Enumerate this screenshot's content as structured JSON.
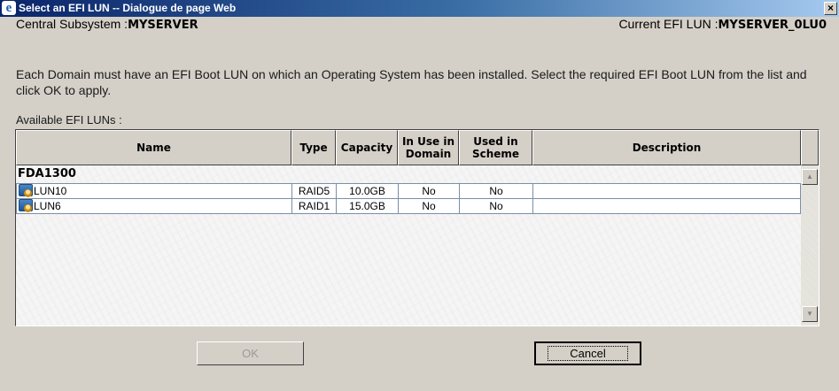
{
  "window": {
    "title": "Select an EFI LUN -- Dialogue de page Web",
    "close_glyph": "×"
  },
  "header": {
    "subsystem_label": "Central Subsystem :",
    "subsystem_value": "MYSERVER",
    "current_lun_label": "Current EFI LUN :",
    "current_lun_value": "MYSERVER_0LU0"
  },
  "instructions": "Each Domain must have an EFI Boot LUN on which an Operating System has been installed. Select the required EFI Boot LUN from the list and click OK to apply.",
  "list_label": "Available EFI LUNs :",
  "table": {
    "columns": [
      {
        "label": "Name"
      },
      {
        "label": "Type"
      },
      {
        "label": "Capacity"
      },
      {
        "label": "In Use in Domain"
      },
      {
        "label": "Used in Scheme"
      },
      {
        "label": "Description"
      }
    ],
    "group": "FDA1300",
    "rows": [
      {
        "name": "LUN10",
        "type": "RAID5",
        "capacity": "10.0GB",
        "in_use": "No",
        "used_in_scheme": "No",
        "description": ""
      },
      {
        "name": "LUN6",
        "type": "RAID1",
        "capacity": "15.0GB",
        "in_use": "No",
        "used_in_scheme": "No",
        "description": ""
      }
    ]
  },
  "scrollbar": {
    "up_glyph": "▲",
    "down_glyph": "▼"
  },
  "buttons": {
    "ok_label": "OK",
    "ok_enabled": false,
    "cancel_label": "Cancel"
  },
  "icons": {
    "title_icon": "internet-explorer-icon",
    "lun_icon": "lun-disk-icon"
  }
}
